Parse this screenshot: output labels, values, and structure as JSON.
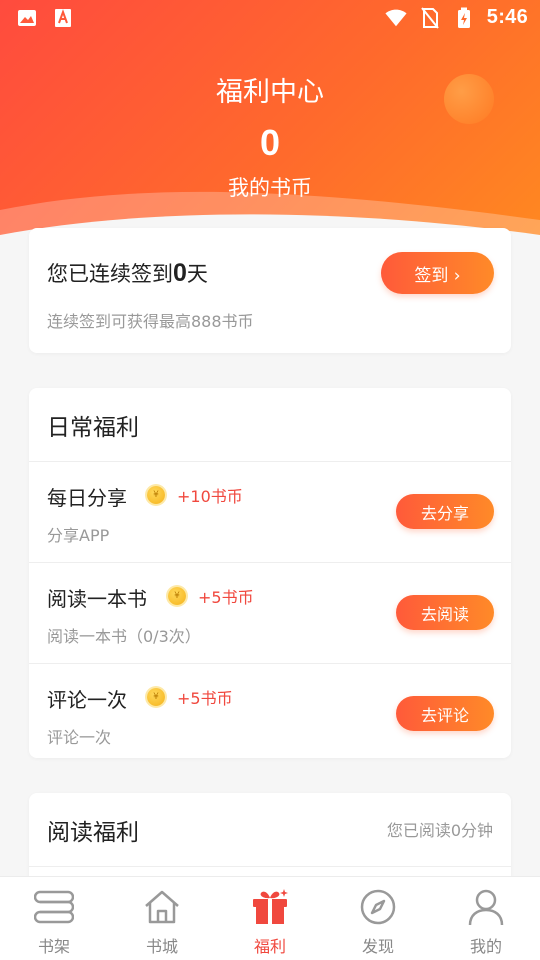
{
  "status_bar": {
    "time": "5:46",
    "left_icons": [
      "image-icon",
      "text-app-icon"
    ],
    "right_icons": [
      "wifi-icon",
      "no-sim-icon",
      "battery-charging-icon"
    ]
  },
  "header": {
    "title": "福利中心",
    "coins": "0",
    "coins_label": "我的书币"
  },
  "checkin": {
    "prefix": "您已连续签到",
    "days": "0",
    "suffix": "天",
    "description": "连续签到可获得最高888书币",
    "button_label": "签到 ›"
  },
  "daily": {
    "title": "日常福利",
    "tasks": [
      {
        "name": "每日分享",
        "reward": "+10书币",
        "desc": "分享APP",
        "button": "去分享"
      },
      {
        "name": "阅读一本书",
        "reward": "+5书币",
        "desc": "阅读一本书（0/3次）",
        "button": "去阅读"
      },
      {
        "name": "评论一次",
        "reward": "+5书币",
        "desc": "评论一次",
        "button": "去评论"
      }
    ]
  },
  "reading": {
    "title": "阅读福利",
    "status": "您已阅读0分钟"
  },
  "tabbar": {
    "items": [
      {
        "label": "书架",
        "icon": "bookshelf-icon"
      },
      {
        "label": "书城",
        "icon": "home-icon"
      },
      {
        "label": "福利",
        "icon": "gift-icon",
        "active": true
      },
      {
        "label": "发现",
        "icon": "compass-icon"
      },
      {
        "label": "我的",
        "icon": "user-icon"
      }
    ]
  },
  "colors": {
    "accent": "#f0483e",
    "gradient_start": "#ff4b3e",
    "gradient_end": "#ff8a20"
  }
}
